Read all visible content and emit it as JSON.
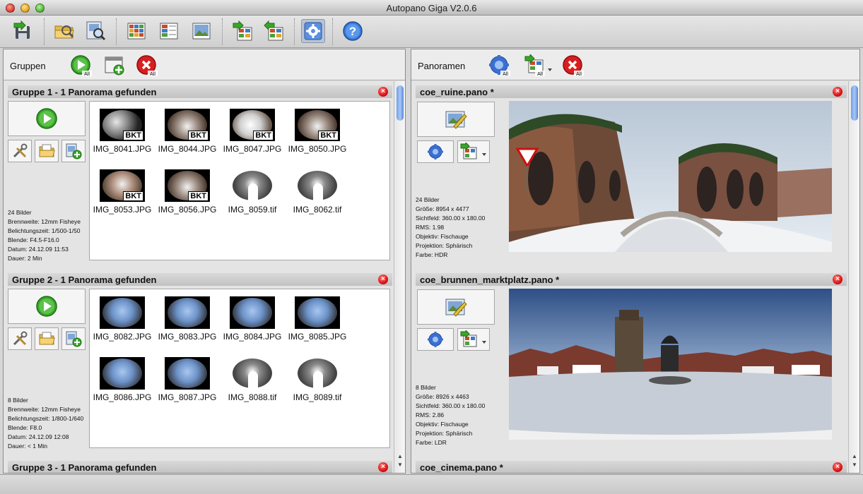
{
  "window": {
    "title": "Autopano Giga V2.0.6"
  },
  "toolbar": {
    "icons": [
      "save-import-icon",
      "open-folder-icon",
      "detect-icon",
      "grid-view-icon",
      "list-view-icon",
      "image-view-icon",
      "export-icon",
      "import-export-icon",
      "settings-gear-icon",
      "help-icon"
    ]
  },
  "groups_panel": {
    "title": "Gruppen",
    "badge": "All",
    "groups": [
      {
        "title": "Gruppe 1 - 1 Panorama gefunden",
        "images": [
          {
            "name": "IMG_8041.JPG",
            "bkt": "BKT",
            "tone": "dark"
          },
          {
            "name": "IMG_8044.JPG",
            "bkt": "BKT",
            "tone": "wall"
          },
          {
            "name": "IMG_8047.JPG",
            "bkt": "BKT",
            "tone": "snow"
          },
          {
            "name": "IMG_8050.JPG",
            "bkt": "BKT",
            "tone": "wall"
          },
          {
            "name": "IMG_8053.JPG",
            "bkt": "BKT",
            "tone": "sign"
          },
          {
            "name": "IMG_8056.JPG",
            "bkt": "BKT",
            "tone": "wall"
          },
          {
            "name": "IMG_8059.tif",
            "bkt": "",
            "tone": "mask"
          },
          {
            "name": "IMG_8062.tif",
            "bkt": "",
            "tone": "mask"
          }
        ],
        "info": [
          "24 Bilder",
          "Brennweite: 12mm Fisheye",
          "Belichtungszeit: 1/500-1/50",
          "Blende: F4.5-F16.0",
          "Datum: 24.12.09 11:53",
          "Dauer: 2 Min"
        ]
      },
      {
        "title": "Gruppe 2 - 1 Panorama gefunden",
        "images": [
          {
            "name": "IMG_8082.JPG",
            "bkt": "",
            "tone": "sky"
          },
          {
            "name": "IMG_8083.JPG",
            "bkt": "",
            "tone": "sky"
          },
          {
            "name": "IMG_8084.JPG",
            "bkt": "",
            "tone": "sky"
          },
          {
            "name": "IMG_8085.JPG",
            "bkt": "",
            "tone": "sky"
          },
          {
            "name": "IMG_8086.JPG",
            "bkt": "",
            "tone": "sky"
          },
          {
            "name": "IMG_8087.JPG",
            "bkt": "",
            "tone": "sky"
          },
          {
            "name": "IMG_8088.tif",
            "bkt": "",
            "tone": "mask"
          },
          {
            "name": "IMG_8089.tif",
            "bkt": "",
            "tone": "mask"
          }
        ],
        "info": [
          "8 Bilder",
          "Brennweite: 12mm Fisheye",
          "Belichtungszeit: 1/800-1/640",
          "Blende: F8.0",
          "Datum: 24.12.09 12:08",
          "Dauer: < 1 Min"
        ]
      },
      {
        "title": "Gruppe 3 - 1 Panorama gefunden"
      }
    ]
  },
  "panos_panel": {
    "title": "Panoramen",
    "badge": "All",
    "panos": [
      {
        "title": "coe_ruine.pano *",
        "info": [
          "24 Bilder",
          "Größe: 8954 x 4477",
          "Sichtfeld: 360.00 x 180.00",
          "RMS: 1.98",
          "Objektiv: Fischauge",
          "Projektion: Sphärisch",
          "Farbe: HDR"
        ]
      },
      {
        "title": "coe_brunnen_marktplatz.pano *",
        "info": [
          "8 Bilder",
          "Größe: 8926 x 4463",
          "Sichtfeld: 360.00 x 180.00",
          "RMS: 2.86",
          "Objektiv: Fischauge",
          "Projektion: Sphärisch",
          "Farbe: LDR"
        ]
      },
      {
        "title": "coe_cinema.pano *"
      }
    ]
  }
}
